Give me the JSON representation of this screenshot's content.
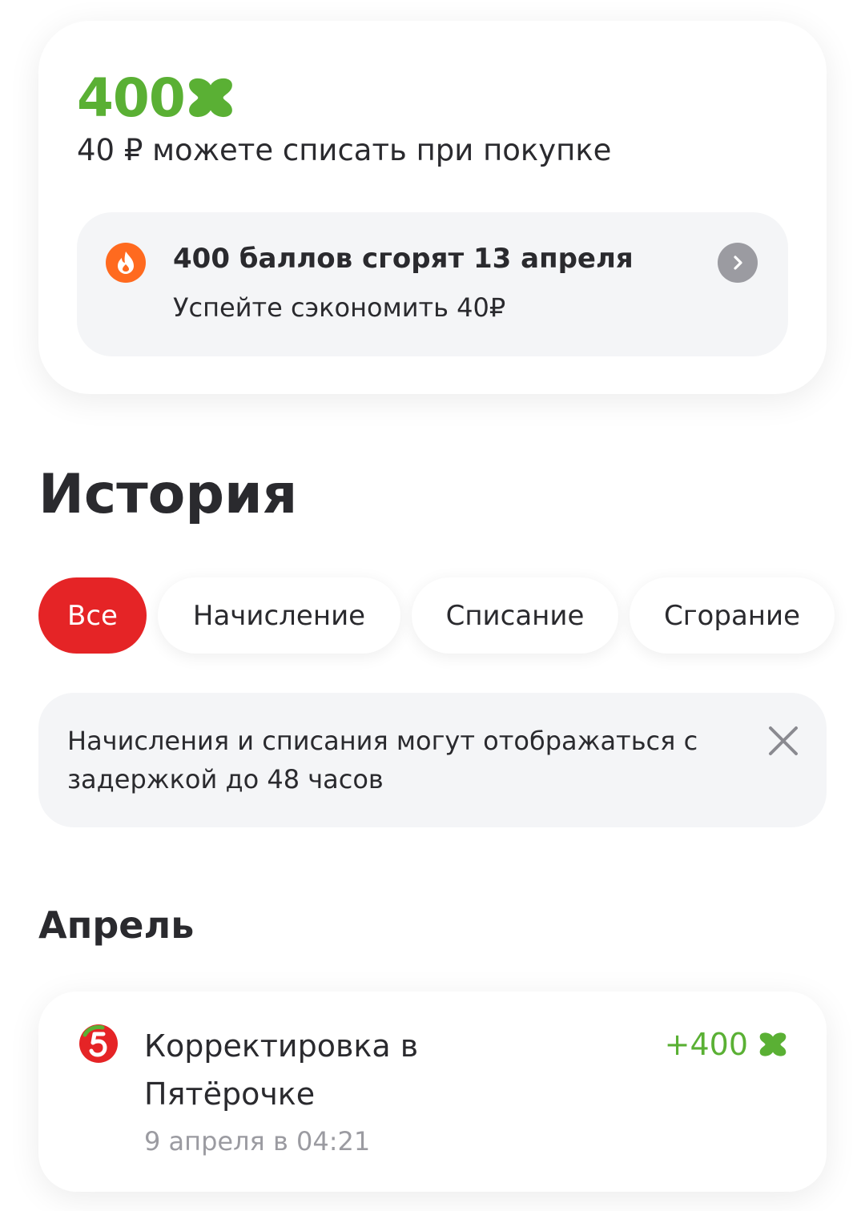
{
  "balance": {
    "points": "400",
    "points_icon": "points-cross-icon",
    "subtitle": "40 ₽ можете списать при покупке"
  },
  "expiry": {
    "title": "400 баллов сгорят 13 апреля",
    "subtitle": "Успейте сэкономить 40₽",
    "icon": "fire-icon"
  },
  "history": {
    "title": "История",
    "filters": [
      {
        "label": "Все",
        "active": true
      },
      {
        "label": "Начисление",
        "active": false
      },
      {
        "label": "Списание",
        "active": false
      },
      {
        "label": "Сгорание",
        "active": false
      }
    ]
  },
  "notice": {
    "text": "Начисления и списания могут отображаться с задержкой до 48 часов"
  },
  "month": "Апрель",
  "transactions": [
    {
      "title": "Корректировка в Пятёрочке",
      "date": "9 апреля в 04:21",
      "amount": "+400",
      "logo": "pyaterochka-logo"
    }
  ],
  "colors": {
    "points_green": "#5ab034",
    "accent_red": "#e52426",
    "fire_orange": "#ff6a1f",
    "muted_gray": "#9b9ba1",
    "surface_gray": "#f4f5f7"
  }
}
